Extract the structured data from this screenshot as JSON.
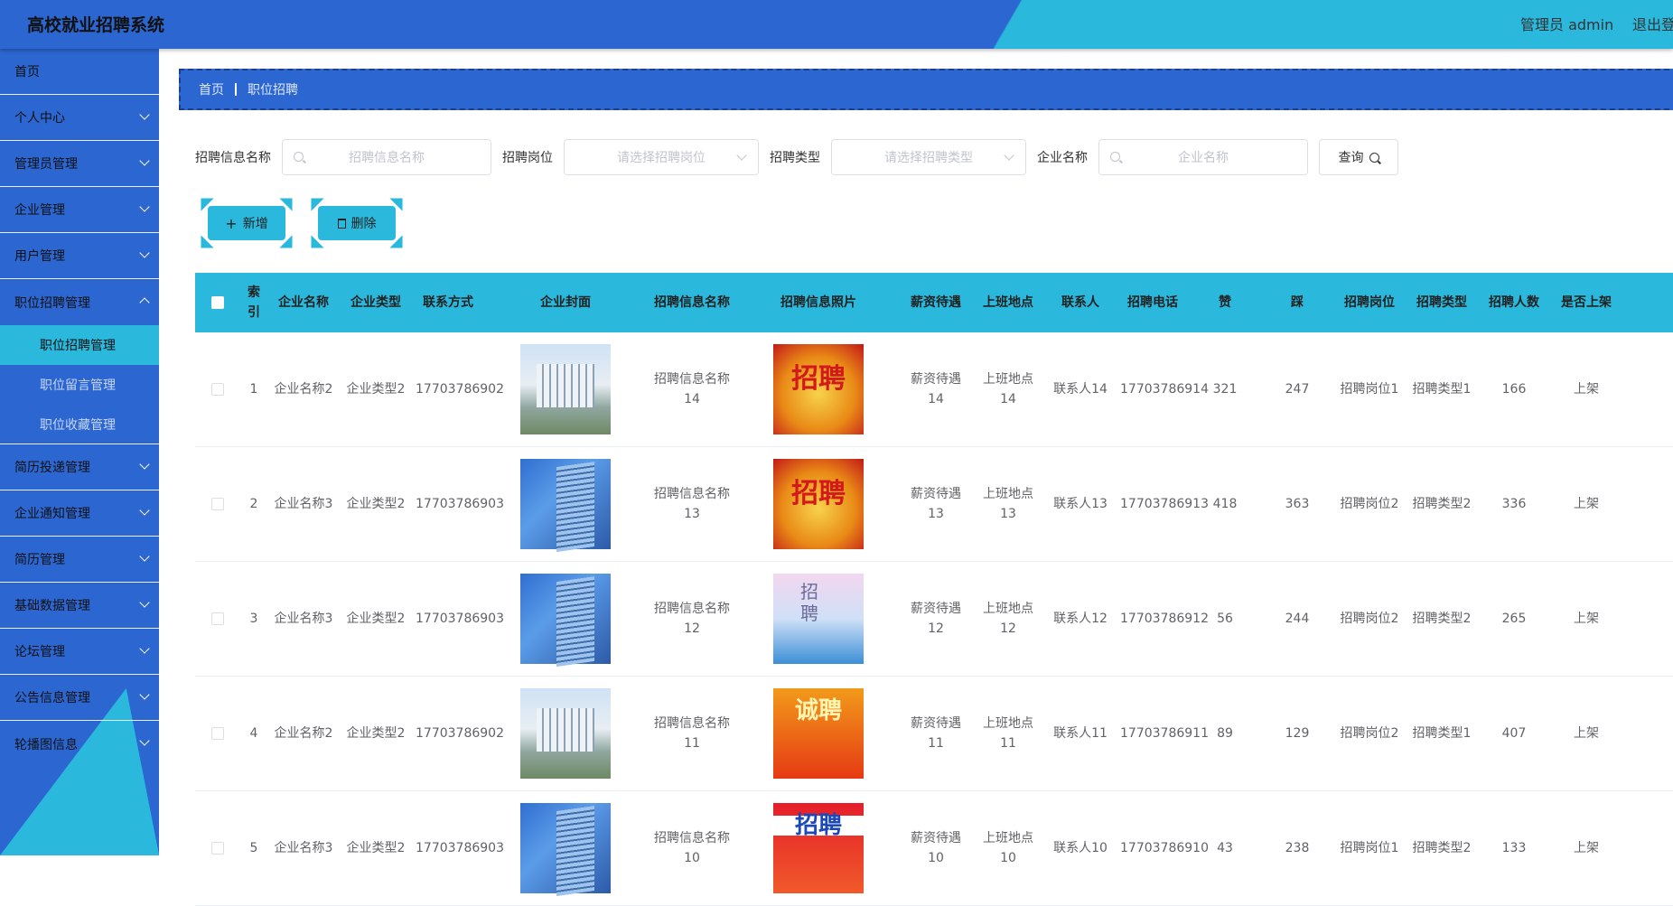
{
  "header": {
    "title": "高校就业招聘系统",
    "admin": "管理员 admin",
    "logout": "退出登录"
  },
  "sidebar": {
    "home": "首页",
    "items": [
      {
        "label": "个人中心"
      },
      {
        "label": "管理员管理"
      },
      {
        "label": "企业管理"
      },
      {
        "label": "用户管理"
      },
      {
        "label": "职位招聘管理"
      },
      {
        "label": "简历投递管理"
      },
      {
        "label": "企业通知管理"
      },
      {
        "label": "简历管理"
      },
      {
        "label": "基础数据管理"
      },
      {
        "label": "论坛管理"
      },
      {
        "label": "公告信息管理"
      },
      {
        "label": "轮播图信息"
      }
    ],
    "sub": [
      {
        "label": "职位招聘管理"
      },
      {
        "label": "职位留言管理"
      },
      {
        "label": "职位收藏管理"
      }
    ]
  },
  "breadcrumb": {
    "home": "首页",
    "current": "职位招聘"
  },
  "search": {
    "name_label": "招聘信息名称",
    "name_placeholder": "招聘信息名称",
    "post_label": "招聘岗位",
    "post_placeholder": "请选择招聘岗位",
    "type_label": "招聘类型",
    "type_placeholder": "请选择招聘类型",
    "company_label": "企业名称",
    "company_placeholder": "企业名称",
    "query": "查询"
  },
  "actions": {
    "add": "新增",
    "delete": "删除"
  },
  "table": {
    "columns": [
      "索引",
      "企业名称",
      "企业类型",
      "联系方式",
      "企业封面",
      "招聘信息名称",
      "招聘信息照片",
      "薪资待遇",
      "上班地点",
      "联系人",
      "招聘电话",
      "赞",
      "踩",
      "招聘岗位",
      "招聘类型",
      "招聘人数",
      "是否上架"
    ],
    "rows": [
      {
        "idx": "1",
        "company": "企业名称2",
        "ctype": "企业类型2",
        "phone": "17703786902",
        "cover": "building1",
        "name": "招聘信息名称14",
        "photo": "poster1",
        "salary": "薪资待遇14",
        "place": "上班地点14",
        "contact": "联系人14",
        "tel": "17703786914",
        "up": "321",
        "down": "247",
        "post": "招聘岗位1",
        "rtype": "招聘类型1",
        "count": "166",
        "status": "上架"
      },
      {
        "idx": "2",
        "company": "企业名称3",
        "ctype": "企业类型2",
        "phone": "17703786903",
        "cover": "building2",
        "name": "招聘信息名称13",
        "photo": "poster1",
        "salary": "薪资待遇13",
        "place": "上班地点13",
        "contact": "联系人13",
        "tel": "17703786913",
        "up": "418",
        "down": "363",
        "post": "招聘岗位2",
        "rtype": "招聘类型2",
        "count": "336",
        "status": "上架"
      },
      {
        "idx": "3",
        "company": "企业名称3",
        "ctype": "企业类型2",
        "phone": "17703786903",
        "cover": "building2",
        "name": "招聘信息名称12",
        "photo": "poster2",
        "salary": "薪资待遇12",
        "place": "上班地点12",
        "contact": "联系人12",
        "tel": "17703786912",
        "up": "56",
        "down": "244",
        "post": "招聘岗位2",
        "rtype": "招聘类型2",
        "count": "265",
        "status": "上架"
      },
      {
        "idx": "4",
        "company": "企业名称2",
        "ctype": "企业类型2",
        "phone": "17703786902",
        "cover": "building1",
        "name": "招聘信息名称11",
        "photo": "poster3",
        "salary": "薪资待遇11",
        "place": "上班地点11",
        "contact": "联系人11",
        "tel": "17703786911",
        "up": "89",
        "down": "129",
        "post": "招聘岗位2",
        "rtype": "招聘类型1",
        "count": "407",
        "status": "上架"
      },
      {
        "idx": "5",
        "company": "企业名称3",
        "ctype": "企业类型2",
        "phone": "17703786903",
        "cover": "building2",
        "name": "招聘信息名称10",
        "photo": "poster4",
        "salary": "薪资待遇10",
        "place": "上班地点10",
        "contact": "联系人10",
        "tel": "17703786910",
        "up": "43",
        "down": "238",
        "post": "招聘岗位1",
        "rtype": "招聘类型2",
        "count": "133",
        "status": "上架"
      }
    ]
  }
}
